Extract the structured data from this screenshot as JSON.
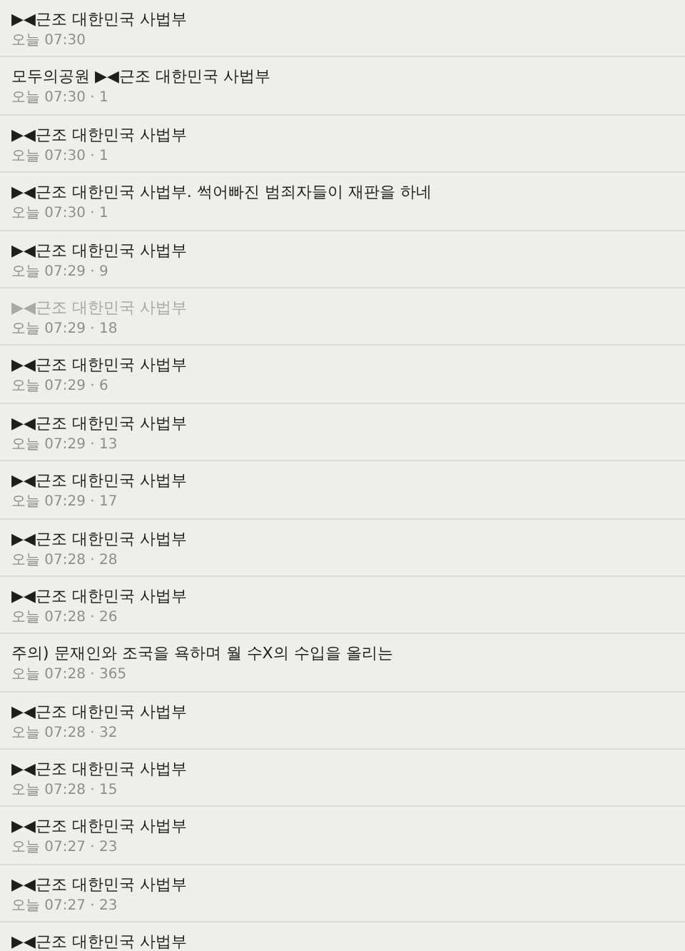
{
  "posts": [
    {
      "title": "▶◀근조 대한민국 사법부",
      "meta": "오늘 07:30",
      "visited": false
    },
    {
      "title": "모두의공원 ▶◀근조 대한민국 사법부",
      "meta": "오늘 07:30 · 1",
      "visited": false
    },
    {
      "title": "▶◀근조 대한민국 사법부",
      "meta": "오늘 07:30 · 1",
      "visited": false
    },
    {
      "title": "▶◀근조 대한민국 사법부. 썩어빠진 범죄자들이 재판을 하네",
      "meta": "오늘 07:30 · 1",
      "visited": false
    },
    {
      "title": "▶◀근조 대한민국 사법부",
      "meta": "오늘 07:29 · 9",
      "visited": false
    },
    {
      "title": "▶◀근조 대한민국 사법부",
      "meta": "오늘 07:29 · 18",
      "visited": true
    },
    {
      "title": "▶◀근조 대한민국 사법부",
      "meta": "오늘 07:29 · 6",
      "visited": false
    },
    {
      "title": "▶◀근조 대한민국 사법부",
      "meta": "오늘 07:29 · 13",
      "visited": false
    },
    {
      "title": "▶◀근조 대한민국 사법부",
      "meta": "오늘 07:29 · 17",
      "visited": false
    },
    {
      "title": "▶◀근조 대한민국 사법부",
      "meta": "오늘 07:28 · 28",
      "visited": false
    },
    {
      "title": "▶◀근조 대한민국 사법부",
      "meta": "오늘 07:28 · 26",
      "visited": false
    },
    {
      "title": "주의) 문재인와 조국을 욕하며 월 수X의 수입을 올리는",
      "meta": "오늘 07:28 · 365",
      "visited": false
    },
    {
      "title": "▶◀근조 대한민국 사법부",
      "meta": "오늘 07:28 · 32",
      "visited": false
    },
    {
      "title": "▶◀근조 대한민국 사법부",
      "meta": "오늘 07:28 · 15",
      "visited": false
    },
    {
      "title": "▶◀근조 대한민국 사법부",
      "meta": "오늘 07:27 · 23",
      "visited": false
    },
    {
      "title": "▶◀근조 대한민국 사법부",
      "meta": "오늘 07:27 · 23",
      "visited": false
    },
    {
      "title": "▶◀근조 대한민국 사법부",
      "visited": false
    }
  ]
}
